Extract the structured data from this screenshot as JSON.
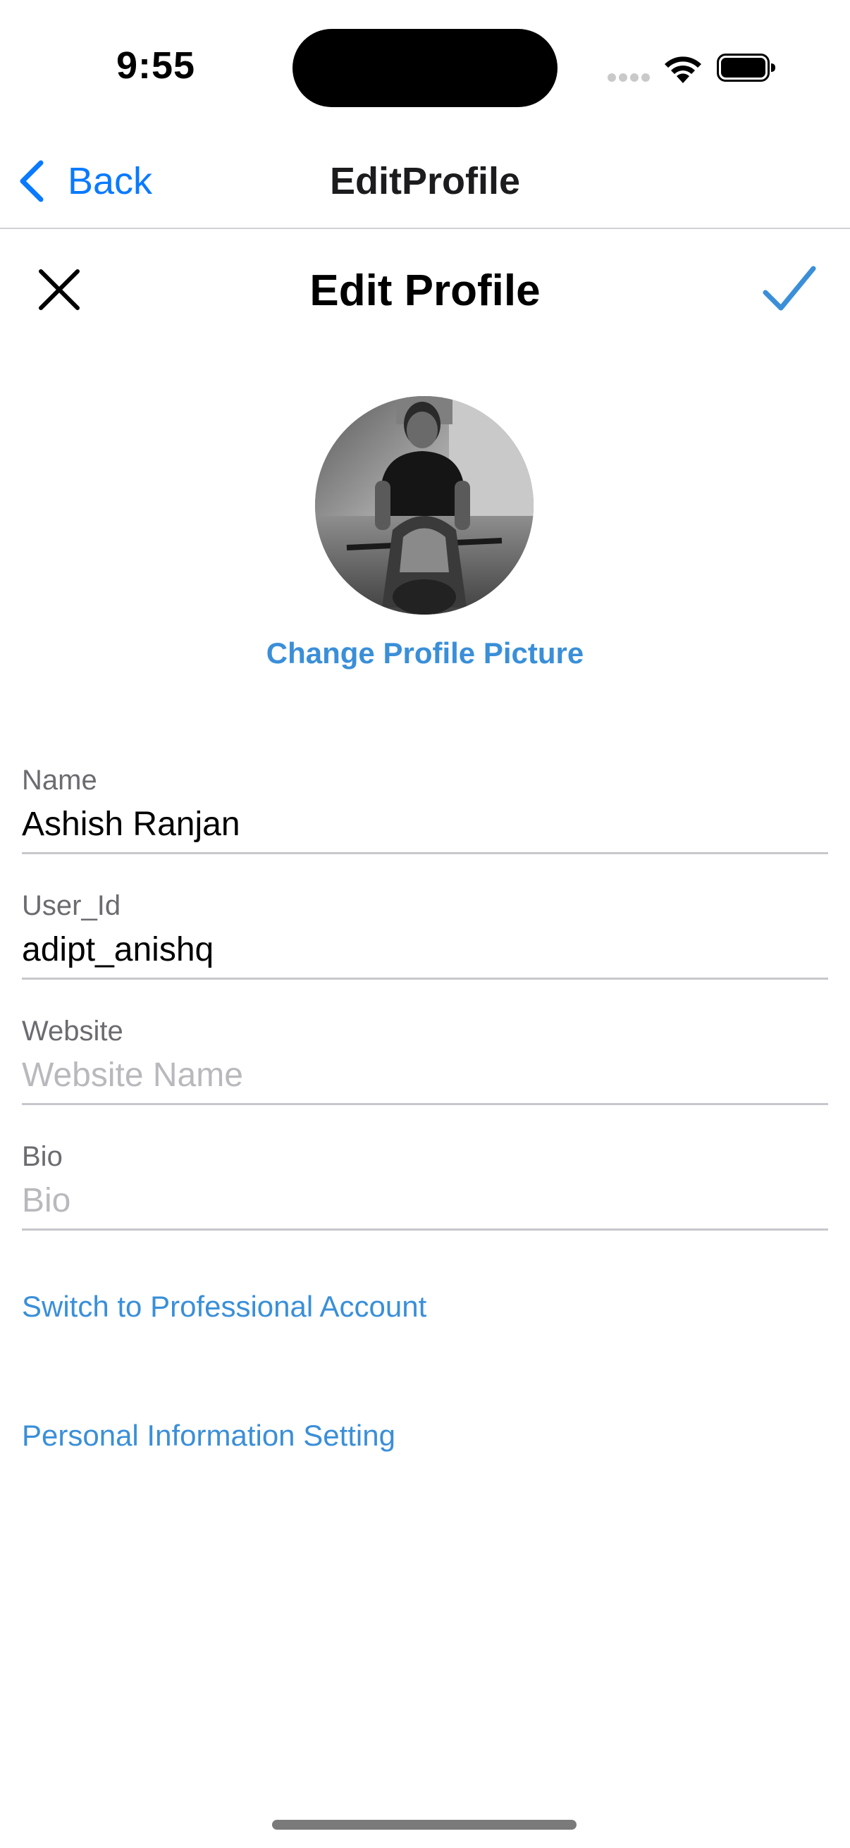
{
  "status_bar": {
    "time": "9:55",
    "icons": [
      "signal-icon",
      "wifi-icon",
      "battery-icon"
    ]
  },
  "nav_bar": {
    "back_label": "Back",
    "title": "EditProfile",
    "accent_color": "#0a7aff"
  },
  "edit_header": {
    "title": "Edit Profile",
    "close_icon": "close-icon",
    "confirm_icon": "checkmark-icon",
    "confirm_color": "#3a8fd8"
  },
  "profile": {
    "change_picture_label": "Change Profile Picture"
  },
  "form": {
    "fields": [
      {
        "label": "Name",
        "value": "Ashish Ranjan",
        "placeholder": ""
      },
      {
        "label": "User_Id",
        "value": "adipt_anishq",
        "placeholder": ""
      },
      {
        "label": "Website",
        "value": "",
        "placeholder": "Website Name"
      },
      {
        "label": "Bio",
        "value": "",
        "placeholder": "Bio"
      }
    ]
  },
  "links": {
    "professional": "Switch to Professional Account",
    "personal_info": "Personal Information Setting"
  }
}
